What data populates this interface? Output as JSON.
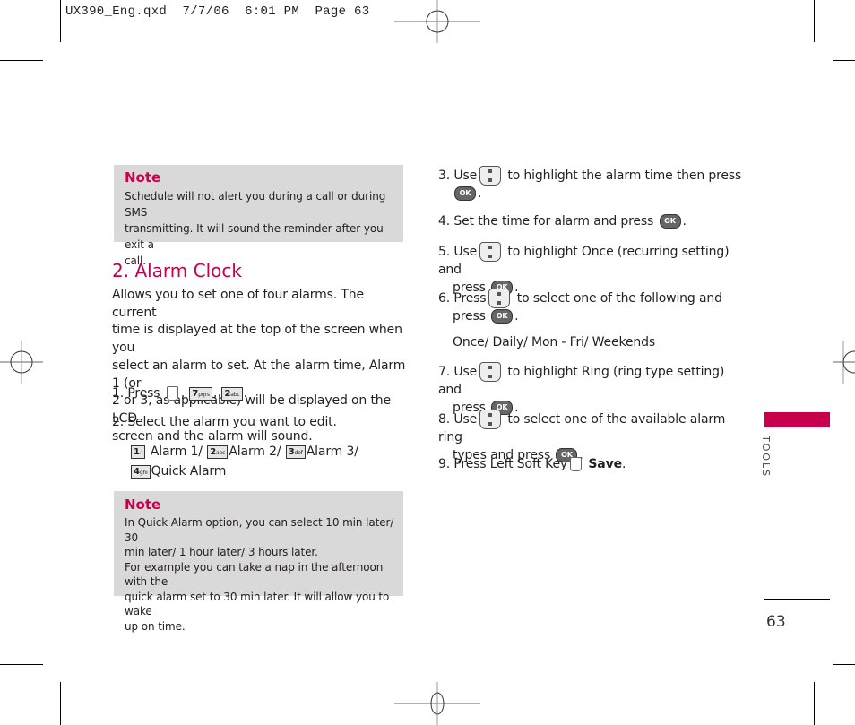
{
  "slug": {
    "file": "UX390_Eng.qxd",
    "date": "7/7/06",
    "time": "6:01 PM",
    "page_label": "Page 63"
  },
  "note1": {
    "title": "Note",
    "lines": [
      "Schedule will not alert you during a call or during SMS",
      "transmitting. It will sound the reminder after you exit a",
      "call."
    ]
  },
  "section": {
    "heading": "2. Alarm Clock",
    "intro_lines": [
      "Allows you to set one of four alarms. The current",
      "time is displayed at the top of the screen when you",
      "select an alarm to set. At the alarm time, Alarm 1  (or",
      "2 or 3, as applicable) will be displayed on the LCD",
      "screen and the alarm will sound."
    ]
  },
  "steps_left": {
    "s1_prefix": "1. Press",
    "s1_keys": [
      {
        "digit": "7",
        "letters": "pqrs"
      },
      {
        "digit": "2",
        "letters": "abc"
      }
    ],
    "s2": "2. Select the alarm you want to edit.",
    "options": [
      {
        "digit": "1",
        "letters": "",
        "label": "Alarm 1/"
      },
      {
        "digit": "2",
        "letters": "abc",
        "label": "Alarm 2/"
      },
      {
        "digit": "3",
        "letters": "def",
        "label": "Alarm 3/"
      },
      {
        "digit": "4",
        "letters": "ghi",
        "label": "Quick Alarm"
      }
    ]
  },
  "note2": {
    "title": "Note",
    "lines": [
      "In Quick Alarm option, you can select 10 min later/ 30",
      "min later/ 1 hour later/ 3 hours later.",
      "For example you can take a nap in the afternoon with the",
      "quick alarm set to 30 min later. It will allow you to wake",
      "up on time."
    ]
  },
  "steps_right": {
    "s3a": "3. Use",
    "s3b": "to highlight the alarm time then press",
    "s4a": "4. Set the time for alarm and press",
    "s5a": "5. Use",
    "s5b": "to highlight Once (recurring setting) and",
    "s5c": "press",
    "s6a": "6. Press",
    "s6b": "to select one of the following and",
    "s6c": "press",
    "s6_options": "Once/ Daily/ Mon - Fri/ Weekends",
    "s7a": "7.  Use",
    "s7b": "to highlight Ring (ring type setting) and",
    "s7c": "press",
    "s8a": "8. Use",
    "s8b": "to select one of the available alarm ring",
    "s8c": "types and press",
    "s9a": "9. Press Left Soft Key",
    "s9b": "Save"
  },
  "ok_label": "OK",
  "side_tab": {
    "label": "TOOLS",
    "color": "#c8004c"
  },
  "page_number": "63",
  "accent_color": "#c8004c"
}
